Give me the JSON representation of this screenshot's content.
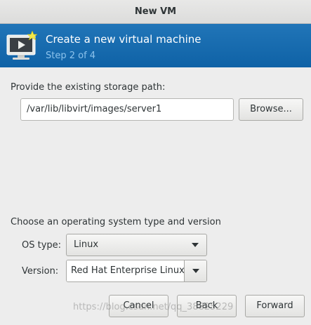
{
  "window": {
    "title": "New VM"
  },
  "banner": {
    "title": "Create a new virtual machine",
    "step": "Step 2 of 4"
  },
  "storage": {
    "label": "Provide the existing storage path:",
    "path_value": "/var/lib/libvirt/images/server1",
    "browse_label": "Browse..."
  },
  "os": {
    "section_label": "Choose an operating system type and version",
    "type_label": "OS type:",
    "type_value": "Linux",
    "version_label": "Version:",
    "version_value": "Red Hat Enterprise Linux"
  },
  "buttons": {
    "cancel": "Cancel",
    "back": "Back",
    "forward": "Forward"
  },
  "watermark": "https://blog.csdn.net/qq_38825229",
  "icons": {
    "banner": "vm-monitor-star-icon",
    "dropdown": "chevron-down-icon"
  }
}
